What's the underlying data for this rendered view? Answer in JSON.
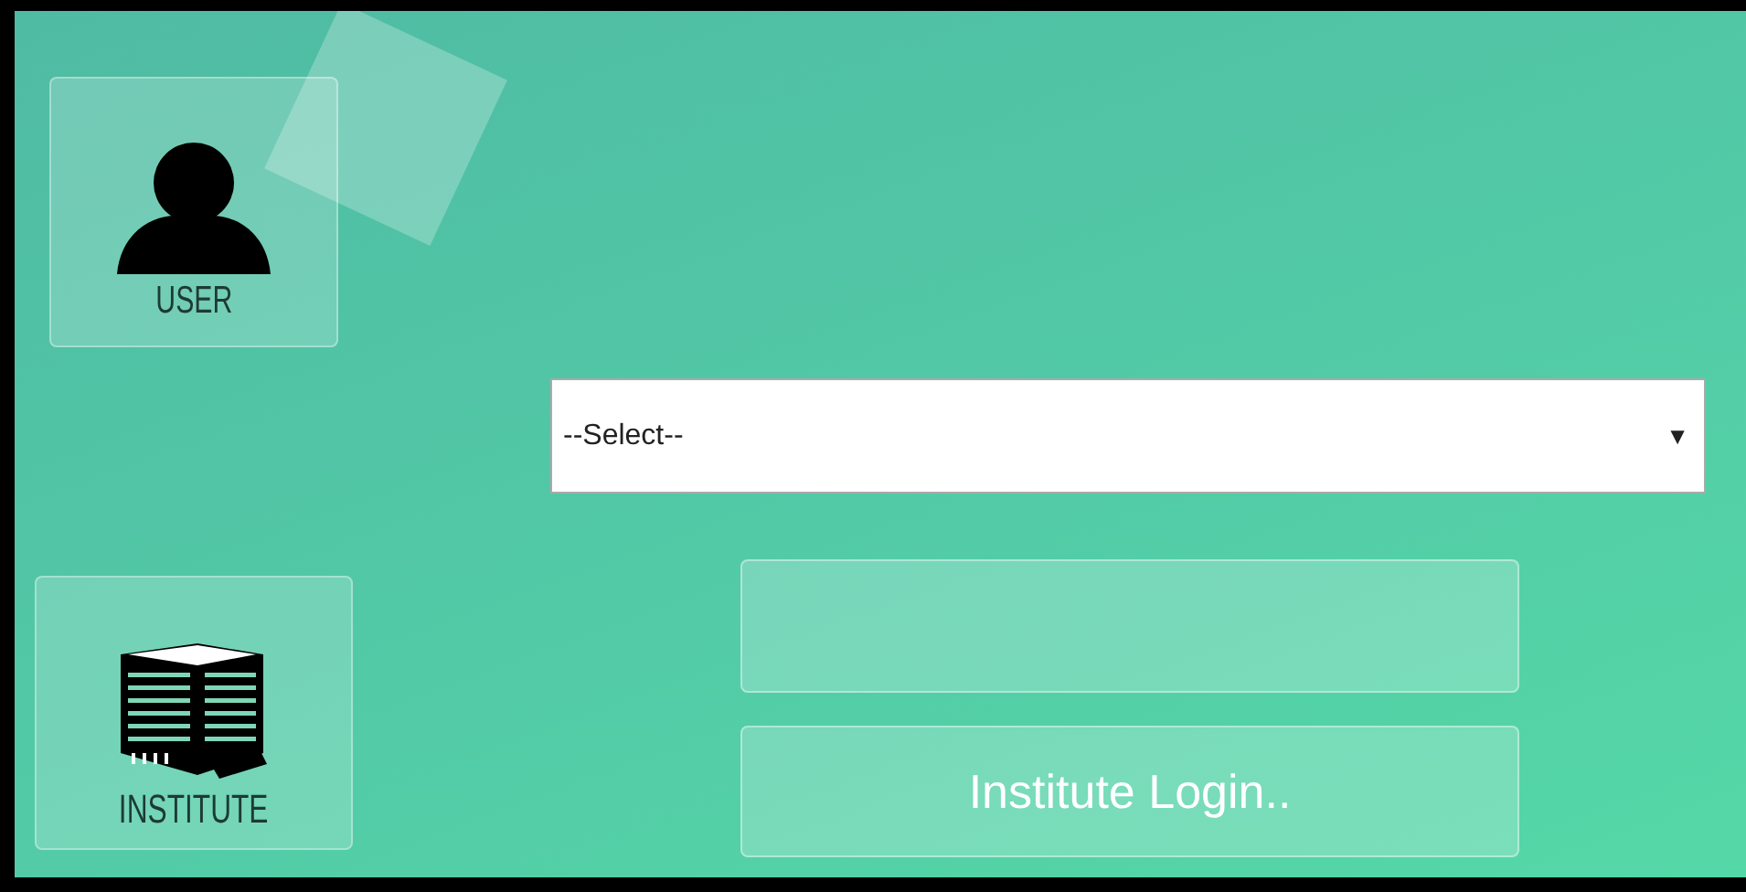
{
  "tiles": [
    {
      "kind": "user",
      "label": "USER"
    },
    {
      "kind": "institute",
      "label": "INSTITUTE"
    }
  ],
  "select": {
    "value": "--Select--",
    "arrow": "▼"
  },
  "button": {
    "label": "Institute Login.."
  }
}
